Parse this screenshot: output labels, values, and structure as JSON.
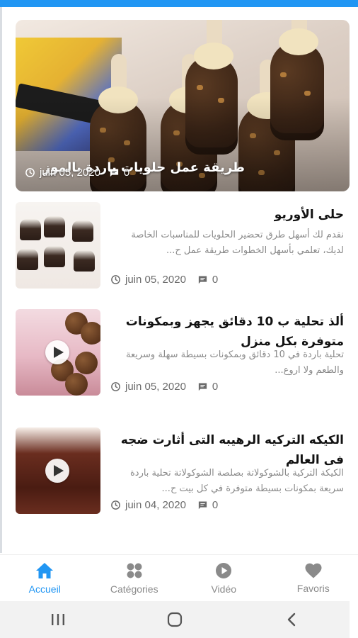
{
  "hero": {
    "title": "طريقة عمل حلويات باردة بالموز",
    "date": "juin 05, 2020",
    "comments": "0"
  },
  "posts": [
    {
      "title": "حلى الأوريو",
      "excerpt": "نقدم لك أسهل طرق تحضير الحلويات للمناسبات الخاصة لديك، تعلمي بأسهل الخطوات طريقة عمل ح...",
      "date": "juin 05, 2020",
      "comments": "0",
      "has_video": false
    },
    {
      "title": "ألذ تحلية ب 10 دقائق يجهز وبمكونات متوفرة بكل منزل",
      "excerpt": "تحلية باردة في 10 دقائق وبمكونات بسيطة سهلة وسريعة والطعم ولا اروع...",
      "date": "juin 05, 2020",
      "comments": "0",
      "has_video": true
    },
    {
      "title": "الكيكه التركيه الرهيبه التى أثارت ضجه فى العالم",
      "excerpt": "الكيكة التركية بالشوكولاتة بصلصة الشوكولاتة تحلية باردة سريعة بمكونات بسيطة متوفرة في كل بيت ح...",
      "date": "juin 04, 2020",
      "comments": "0",
      "has_video": true
    }
  ],
  "nav": {
    "items": [
      {
        "label": "Accueil",
        "icon": "home-icon",
        "active": true
      },
      {
        "label": "Catégories",
        "icon": "grid-icon",
        "active": false
      },
      {
        "label": "Vidéo",
        "icon": "play-circle-icon",
        "active": false
      },
      {
        "label": "Favoris",
        "icon": "heart-icon",
        "active": false
      }
    ]
  },
  "colors": {
    "accent": "#2196f3",
    "inactive": "#8a8a8a",
    "text": "#121212",
    "muted": "#8a8a8a"
  }
}
